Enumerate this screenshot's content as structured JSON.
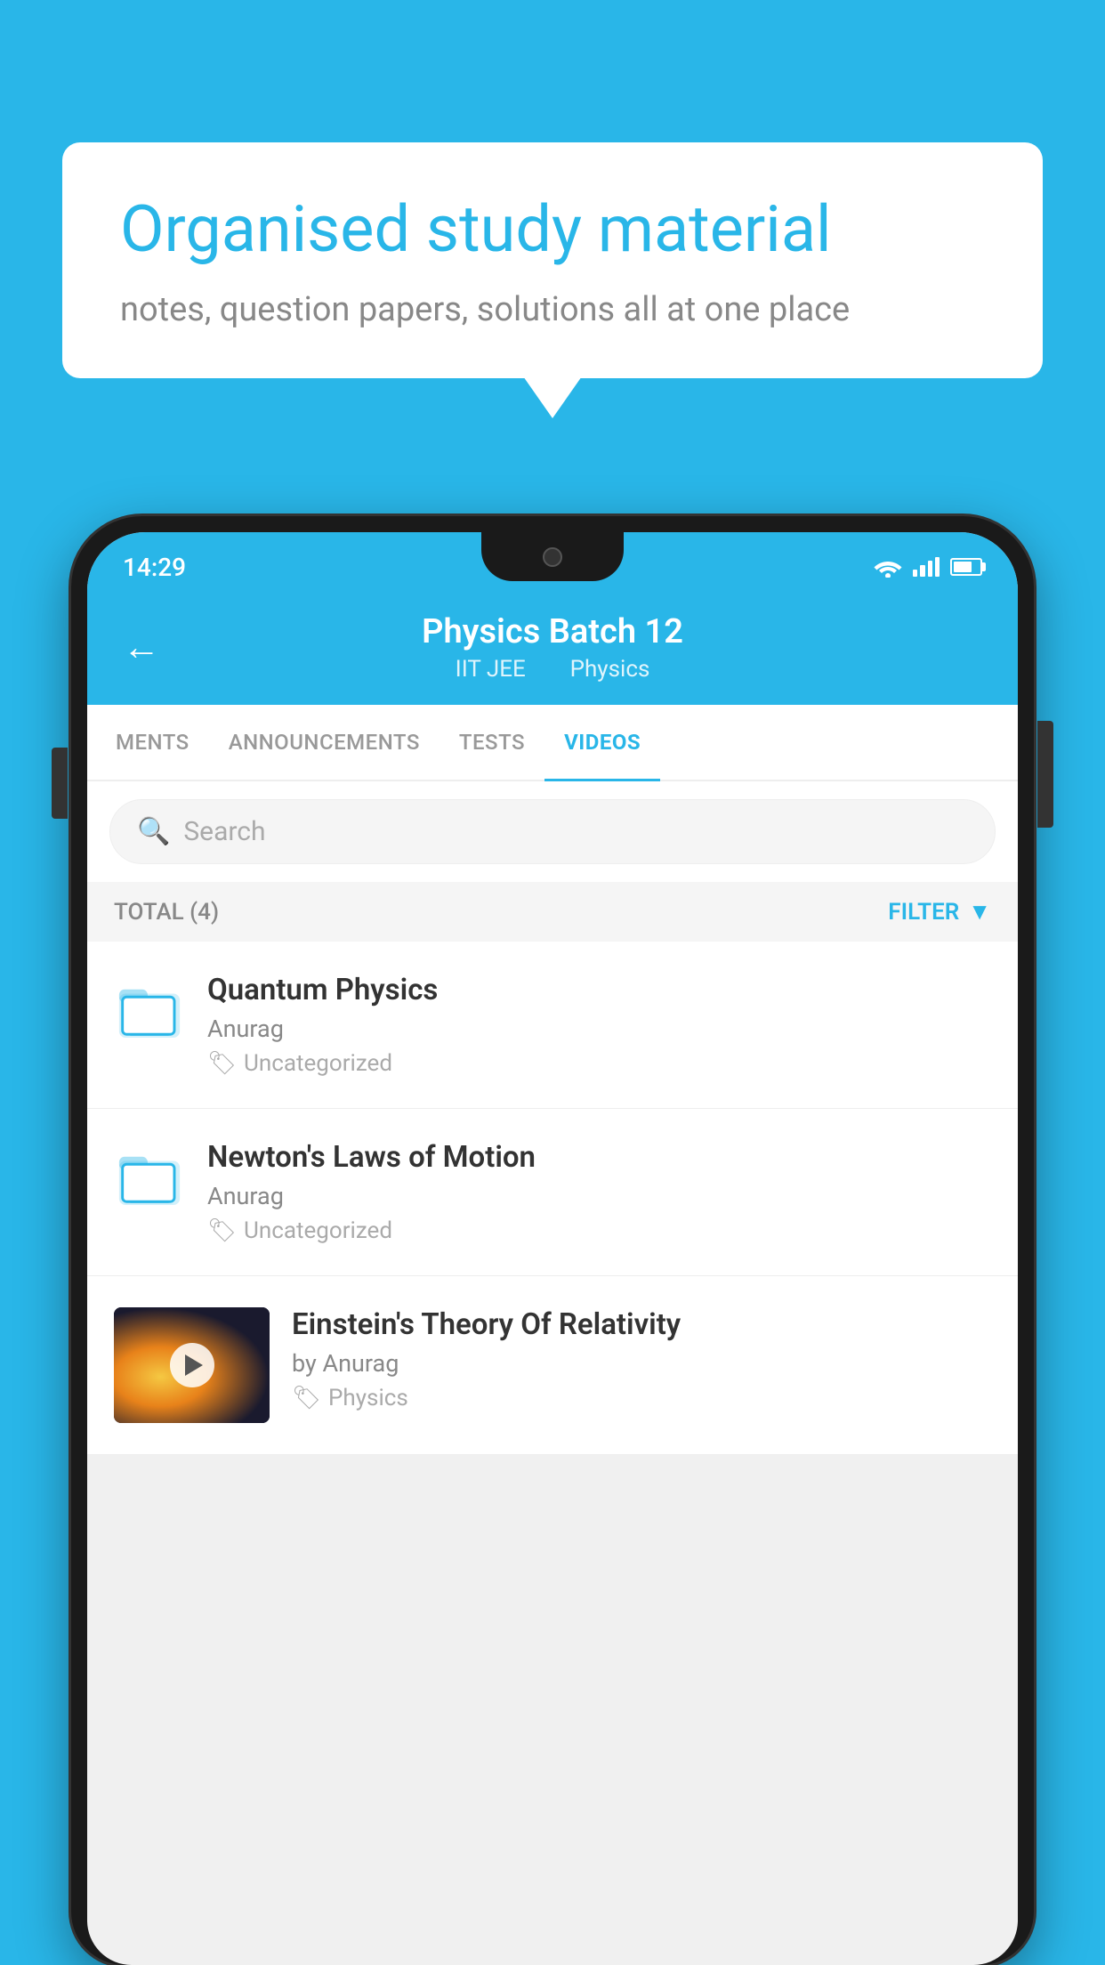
{
  "background_color": "#29b6e8",
  "bubble": {
    "title": "Organised study material",
    "subtitle": "notes, question papers, solutions all at one place"
  },
  "phone": {
    "status_bar": {
      "time": "14:29",
      "wifi": "▼",
      "battery_label": "battery"
    },
    "header": {
      "title": "Physics Batch 12",
      "subtitle_parts": [
        "IIT JEE",
        "Physics"
      ],
      "back_label": "back"
    },
    "tabs": [
      {
        "label": "MENTS",
        "active": false
      },
      {
        "label": "ANNOUNCEMENTS",
        "active": false
      },
      {
        "label": "TESTS",
        "active": false
      },
      {
        "label": "VIDEOS",
        "active": true
      }
    ],
    "search": {
      "placeholder": "Search"
    },
    "filter_bar": {
      "total_label": "TOTAL (4)",
      "filter_label": "FILTER"
    },
    "videos": [
      {
        "title": "Quantum Physics",
        "author": "Anurag",
        "tag": "Uncategorized",
        "has_thumb": false
      },
      {
        "title": "Newton's Laws of Motion",
        "author": "Anurag",
        "tag": "Uncategorized",
        "has_thumb": false
      },
      {
        "title": "Einstein's Theory Of Relativity",
        "author": "by Anurag",
        "tag": "Physics",
        "has_thumb": true
      }
    ]
  }
}
